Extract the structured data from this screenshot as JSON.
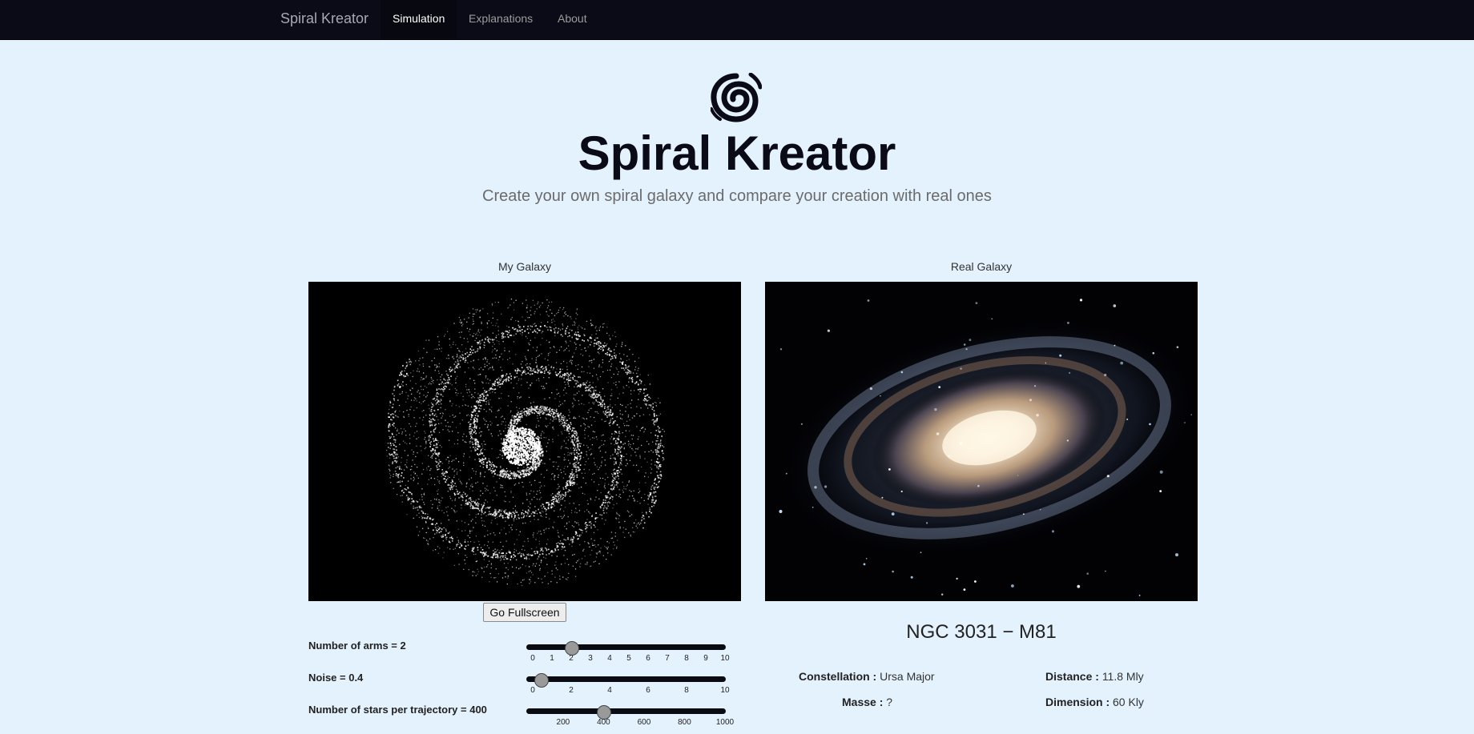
{
  "navbar": {
    "brand": "Spiral Kreator",
    "items": [
      {
        "label": "Simulation",
        "active": true
      },
      {
        "label": "Explanations",
        "active": false
      },
      {
        "label": "About",
        "active": false
      }
    ]
  },
  "hero": {
    "logo_icon": "spiral-galaxy-icon",
    "title": "Spiral Kreator",
    "subtitle": "Create your own spiral galaxy and compare your creation with real ones"
  },
  "my_galaxy": {
    "title": "My Galaxy",
    "fullscreen_label": "Go Fullscreen",
    "controls": [
      {
        "label": "Number of arms = 2",
        "min": 0,
        "max": 10,
        "value": 2,
        "ticks": [
          "0",
          "1",
          "2",
          "3",
          "4",
          "5",
          "6",
          "7",
          "8",
          "9",
          "10"
        ]
      },
      {
        "label": "Noise = 0.4",
        "min": 0,
        "max": 10,
        "value": 0.4,
        "ticks": [
          "0",
          "2",
          "4",
          "6",
          "8",
          "10"
        ]
      },
      {
        "label": "Number of stars per trajectory = 400",
        "min": 50,
        "max": 1000,
        "value": 400,
        "ticks": [
          "200",
          "400",
          "600",
          "800",
          "1000"
        ]
      }
    ]
  },
  "real_galaxy": {
    "title": "Real Galaxy",
    "name": "NGC 3031 − M81",
    "constellation_label": "Constellation :",
    "constellation": "Ursa Major",
    "distance_label": "Distance :",
    "distance": "11.8 Mly",
    "masse_label": "Masse :",
    "masse": "?",
    "dimension_label": "Dimension :",
    "dimension": "60 Kly"
  },
  "colors": {
    "navbar_bg": "#0b0b17",
    "page_bg": "#e3f2fd",
    "canvas_bg": "#000000"
  }
}
